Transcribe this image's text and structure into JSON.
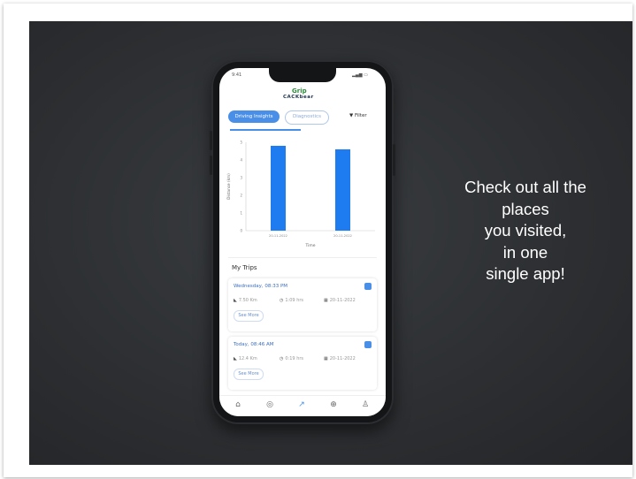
{
  "app": {
    "status_time": "9:41",
    "status_right": "▂▄▆ ▭",
    "logo_mark": "Grip",
    "logo_word": "CACKbear"
  },
  "tabs": {
    "active_label": "Driving Insights",
    "inactive_label": "Diagnostics",
    "filter_label": "Filter",
    "filter_icon": "filter-icon"
  },
  "chart_data": {
    "type": "bar",
    "categories": [
      "20-11-2022",
      "20-11-2022"
    ],
    "values": [
      4.8,
      4.6
    ],
    "xlabel": "Time",
    "ylabel": "Distance (km)",
    "ylim": [
      0,
      5
    ],
    "yticks": [
      0,
      1,
      2,
      3,
      4,
      5
    ],
    "grid": false,
    "colors": {
      "bar": "#1f7cf0"
    }
  },
  "trips": {
    "title": "My Trips",
    "items": [
      {
        "date": "Wednesday, 08:33 PM",
        "distance": "7.50 Km",
        "duration": "1:09 hrs",
        "day": "20-11-2022",
        "see_more": "See More"
      },
      {
        "date": "Today, 08:46 AM",
        "distance": "12.4 Km",
        "duration": "0:19 hrs",
        "day": "20-11-2022",
        "see_more": "See More"
      }
    ]
  },
  "bottom_nav": {
    "items": [
      {
        "icon": "home-icon",
        "glyph": "⌂"
      },
      {
        "icon": "compass-icon",
        "glyph": "◎"
      },
      {
        "icon": "trend-icon",
        "glyph": "↗"
      },
      {
        "icon": "search-doc-icon",
        "glyph": "⊕"
      },
      {
        "icon": "profile-icon",
        "glyph": "♙"
      }
    ]
  },
  "caption": {
    "lines": [
      "Check out all the",
      "places",
      "you visited,",
      "in one",
      "single app!"
    ]
  },
  "colors": {
    "accent": "#4a8fe7",
    "bar": "#1f7cf0",
    "background": "#2e3033"
  }
}
